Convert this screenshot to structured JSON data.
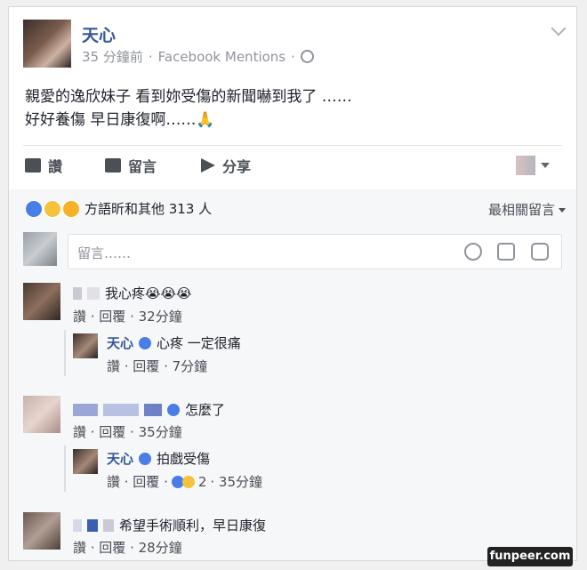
{
  "post": {
    "author": "天心",
    "timestamp": "35 分鐘前",
    "source": "Facebook Mentions",
    "separator": "·",
    "text_line1": "親愛的逸欣妹子 看到妳受傷的新聞嚇到我了 ……",
    "text_line2": "好好養傷 早日康復啊……🙏"
  },
  "actions": {
    "like": "讚",
    "comment": "留言",
    "share": "分享"
  },
  "reactions": {
    "summary": "方語昕和其他 313 人",
    "sort_label": "最相關留言"
  },
  "composer": {
    "placeholder": "留言……"
  },
  "comments": [
    {
      "text": "我心疼😭😭😭",
      "actions": "讚 · 回覆 · 32分鐘",
      "reply": {
        "author": "天心",
        "text": "心疼 一定很痛",
        "actions": "讚 · 回覆 · 7分鐘"
      }
    },
    {
      "text": "怎麼了",
      "actions": "讚 · 回覆 · 35分鐘",
      "reply": {
        "author": "天心",
        "text": "拍戲受傷",
        "actions_prefix": "讚 · 回覆 ·",
        "reaction_count": "2",
        "actions_suffix": "· 35分鐘"
      }
    },
    {
      "text": "希望手術順利，早日康復",
      "actions": "讚 · 回覆 · 28分鐘"
    }
  ],
  "watermark": "funpeer.com",
  "colors": {
    "link_blue": "#365899",
    "like_blue": "#4a7ee6",
    "text": "#1d2129",
    "muted": "#90949c"
  }
}
